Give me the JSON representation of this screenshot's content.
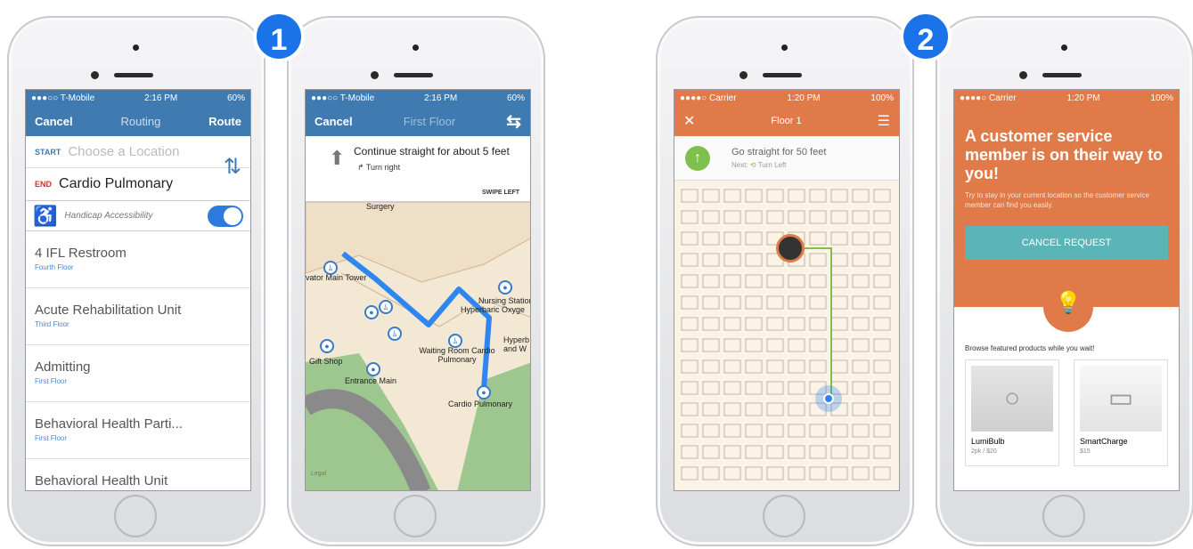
{
  "badges": [
    "1",
    "2"
  ],
  "screen1": {
    "status": {
      "carrier": "●●●○○ T-Mobile",
      "time": "2:16 PM",
      "battery": "60%"
    },
    "nav": {
      "left": "Cancel",
      "title": "Routing",
      "right": "Route"
    },
    "start": {
      "tag": "START",
      "placeholder": "Choose a Location"
    },
    "end": {
      "tag": "END",
      "value": "Cardio Pulmonary"
    },
    "accessibility_label": "Handicap Accessibility",
    "items": [
      {
        "title": "4 IFL Restroom",
        "sub": "Fourth Floor"
      },
      {
        "title": "Acute Rehabilitation Unit",
        "sub": "Third Floor"
      },
      {
        "title": "Admitting",
        "sub": "First Floor"
      },
      {
        "title": "Behavioral Health Parti...",
        "sub": "First Floor"
      },
      {
        "title": "Behavioral Health Unit",
        "sub": ""
      }
    ]
  },
  "screen2": {
    "status": {
      "carrier": "●●●○○ T-Mobile",
      "time": "2:16 PM",
      "battery": "60%"
    },
    "nav": {
      "left": "Cancel",
      "title": "First Floor"
    },
    "instruction": "Continue straight for about 5 feet",
    "next": "Turn right",
    "swipe": "SWIPE LEFT",
    "labels": {
      "surgery": "Surgery",
      "elevator": "vator Main Tower",
      "nursing": "Nursing Station",
      "hyperbaric": "Hyperbaric Oxyge",
      "waiting": "Waiting Room Cardio Pulmonary",
      "hyper2": "Hyperb and W",
      "gift": "Gift Shop",
      "entrance": "Entrance Main",
      "cardio": "Cardio Pulmonary",
      "legal": "Legal"
    }
  },
  "screen3": {
    "status": {
      "carrier": "●●●●○ Carrier",
      "time": "1:20 PM",
      "battery": "100%"
    },
    "nav": {
      "title": "Floor 1"
    },
    "instruction": "Go straight for 50 feet",
    "next_label": "Next:",
    "next": "Turn Left"
  },
  "screen4": {
    "status": {
      "carrier": "●●●●○ Carrier",
      "time": "1:20 PM",
      "battery": "100%"
    },
    "headline": "A customer service member is on their way to you!",
    "sub": "Try to stay in your current location so the customer service member can find you easily.",
    "cancel": "CANCEL REQUEST",
    "browse": "Browse featured products while you wait!",
    "products": [
      {
        "name": "LumiBulb",
        "price": "2pk / $20"
      },
      {
        "name": "SmartCharge",
        "price": "$15"
      }
    ]
  },
  "colors": {
    "blue": "#3f7ab0",
    "orange": "#e07a48",
    "teal": "#5bb5b8",
    "badge": "#1a73e8"
  }
}
